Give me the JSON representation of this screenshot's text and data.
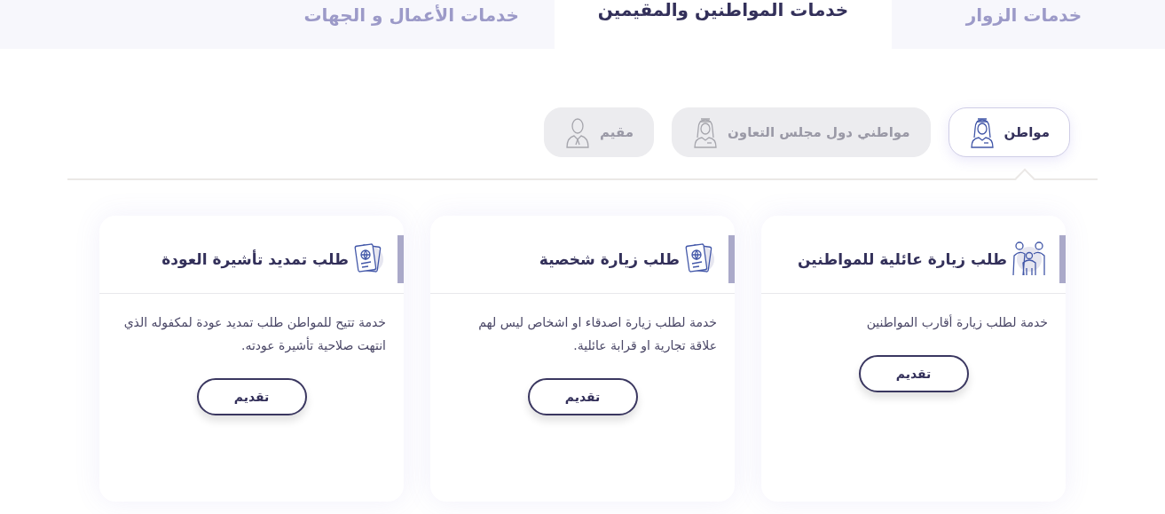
{
  "top_tabs": [
    {
      "label": "خدمات الزوار",
      "selected": false
    },
    {
      "label": "خدمات المواطنين والمقيمين",
      "selected": true
    },
    {
      "label": "خدمات الأعمال و الجهات",
      "selected": false
    }
  ],
  "user_types": [
    {
      "label": "مواطن",
      "selected": true,
      "kind": "citizen"
    },
    {
      "label": "مواطني دول مجلس التعاون",
      "selected": false,
      "kind": "gulf"
    },
    {
      "label": "مقيم",
      "selected": false,
      "kind": "resident"
    }
  ],
  "services": [
    {
      "title": "طلب زيارة عائلية للمواطنين",
      "kind": "family",
      "description": "خدمة لطلب زيارة أقارب المواطنين",
      "button": "تقديم"
    },
    {
      "title": "طلب زيارة شخصية",
      "kind": "passport",
      "description": "خدمة لطلب زيارة اصدقاء او اشخاص ليس لهم علاقة تجارية او قرابة عائلية.",
      "button": "تقديم"
    },
    {
      "title": "طلب تمديد تأشيرة العودة",
      "kind": "passport",
      "description": "خدمة تتيح للمواطن طلب تمديد عودة لمكفوله الذي انتهت صلاحية تأشيرة عودته.",
      "button": "تقديم"
    }
  ]
}
